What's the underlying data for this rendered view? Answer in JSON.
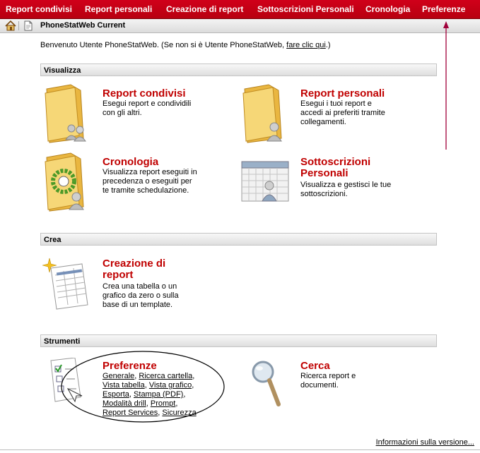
{
  "nav": {
    "items": [
      {
        "label": "Report condivisi"
      },
      {
        "label": "Report personali"
      },
      {
        "label": "Creazione di report"
      },
      {
        "label": "Sottoscrizioni Personali"
      },
      {
        "label": "Cronologia"
      },
      {
        "label": "Preferenze"
      }
    ]
  },
  "breadcrumb": {
    "title": "PhoneStatWeb Current",
    "home_icon": "home-icon",
    "doc_icon": "document-icon"
  },
  "welcome": {
    "text": "Benvenuto Utente PhoneStatWeb. (Se non si è Utente PhoneStatWeb, ",
    "link": "fare clic qui",
    "suffix": ".)"
  },
  "sections": {
    "visualizza": {
      "title": "Visualizza",
      "cards": [
        {
          "title": "Report condivisi",
          "desc": [
            "Esegui report e condividili",
            "con gli altri."
          ],
          "icon": "shared-reports-folder-icon"
        },
        {
          "title": "Report personali",
          "desc": [
            "Esegui i tuoi report e",
            "accedi ai preferiti tramite",
            "collegamenti."
          ],
          "icon": "personal-reports-folder-icon"
        },
        {
          "title": "Cronologia",
          "desc": [
            "Visualizza report eseguiti in",
            "precedenza o eseguiti per",
            "te tramite schedulazione."
          ],
          "icon": "history-folder-icon"
        },
        {
          "title_lines": [
            "Sottoscrizioni",
            "Personali"
          ],
          "desc": [
            "Visualizza e gestisci le tue",
            "sottoscrizioni."
          ],
          "icon": "subscriptions-calendar-icon"
        }
      ]
    },
    "crea": {
      "title": "Crea",
      "cards": [
        {
          "title_lines": [
            "Creazione di",
            "report"
          ],
          "desc": [
            "Crea una tabella o un",
            "grafico da zero o sulla",
            "base di un template."
          ],
          "icon": "report-creation-icon"
        }
      ]
    },
    "strumenti": {
      "title": "Strumenti",
      "cards": [
        {
          "title": "Preferenze",
          "icon": "preferences-checklist-icon",
          "links": [
            [
              "Generale",
              ", ",
              "Ricerca cartella",
              ","
            ],
            [
              "Vista tabella",
              ", ",
              "Vista grafico",
              ","
            ],
            [
              "Esporta",
              ", ",
              "Stampa (PDF)",
              ","
            ],
            [
              "Modalità drill",
              ", ",
              "Prompt",
              ","
            ],
            [
              "Report Services",
              ", ",
              "Sicurezza",
              ""
            ]
          ]
        },
        {
          "title": "Cerca",
          "desc": [
            "Ricerca report e",
            "documenti."
          ],
          "icon": "magnifier-search-icon"
        }
      ]
    }
  },
  "footer": {
    "version_link": "Informazioni sulla versione..."
  },
  "annotation": {
    "color": "#a0003a"
  }
}
